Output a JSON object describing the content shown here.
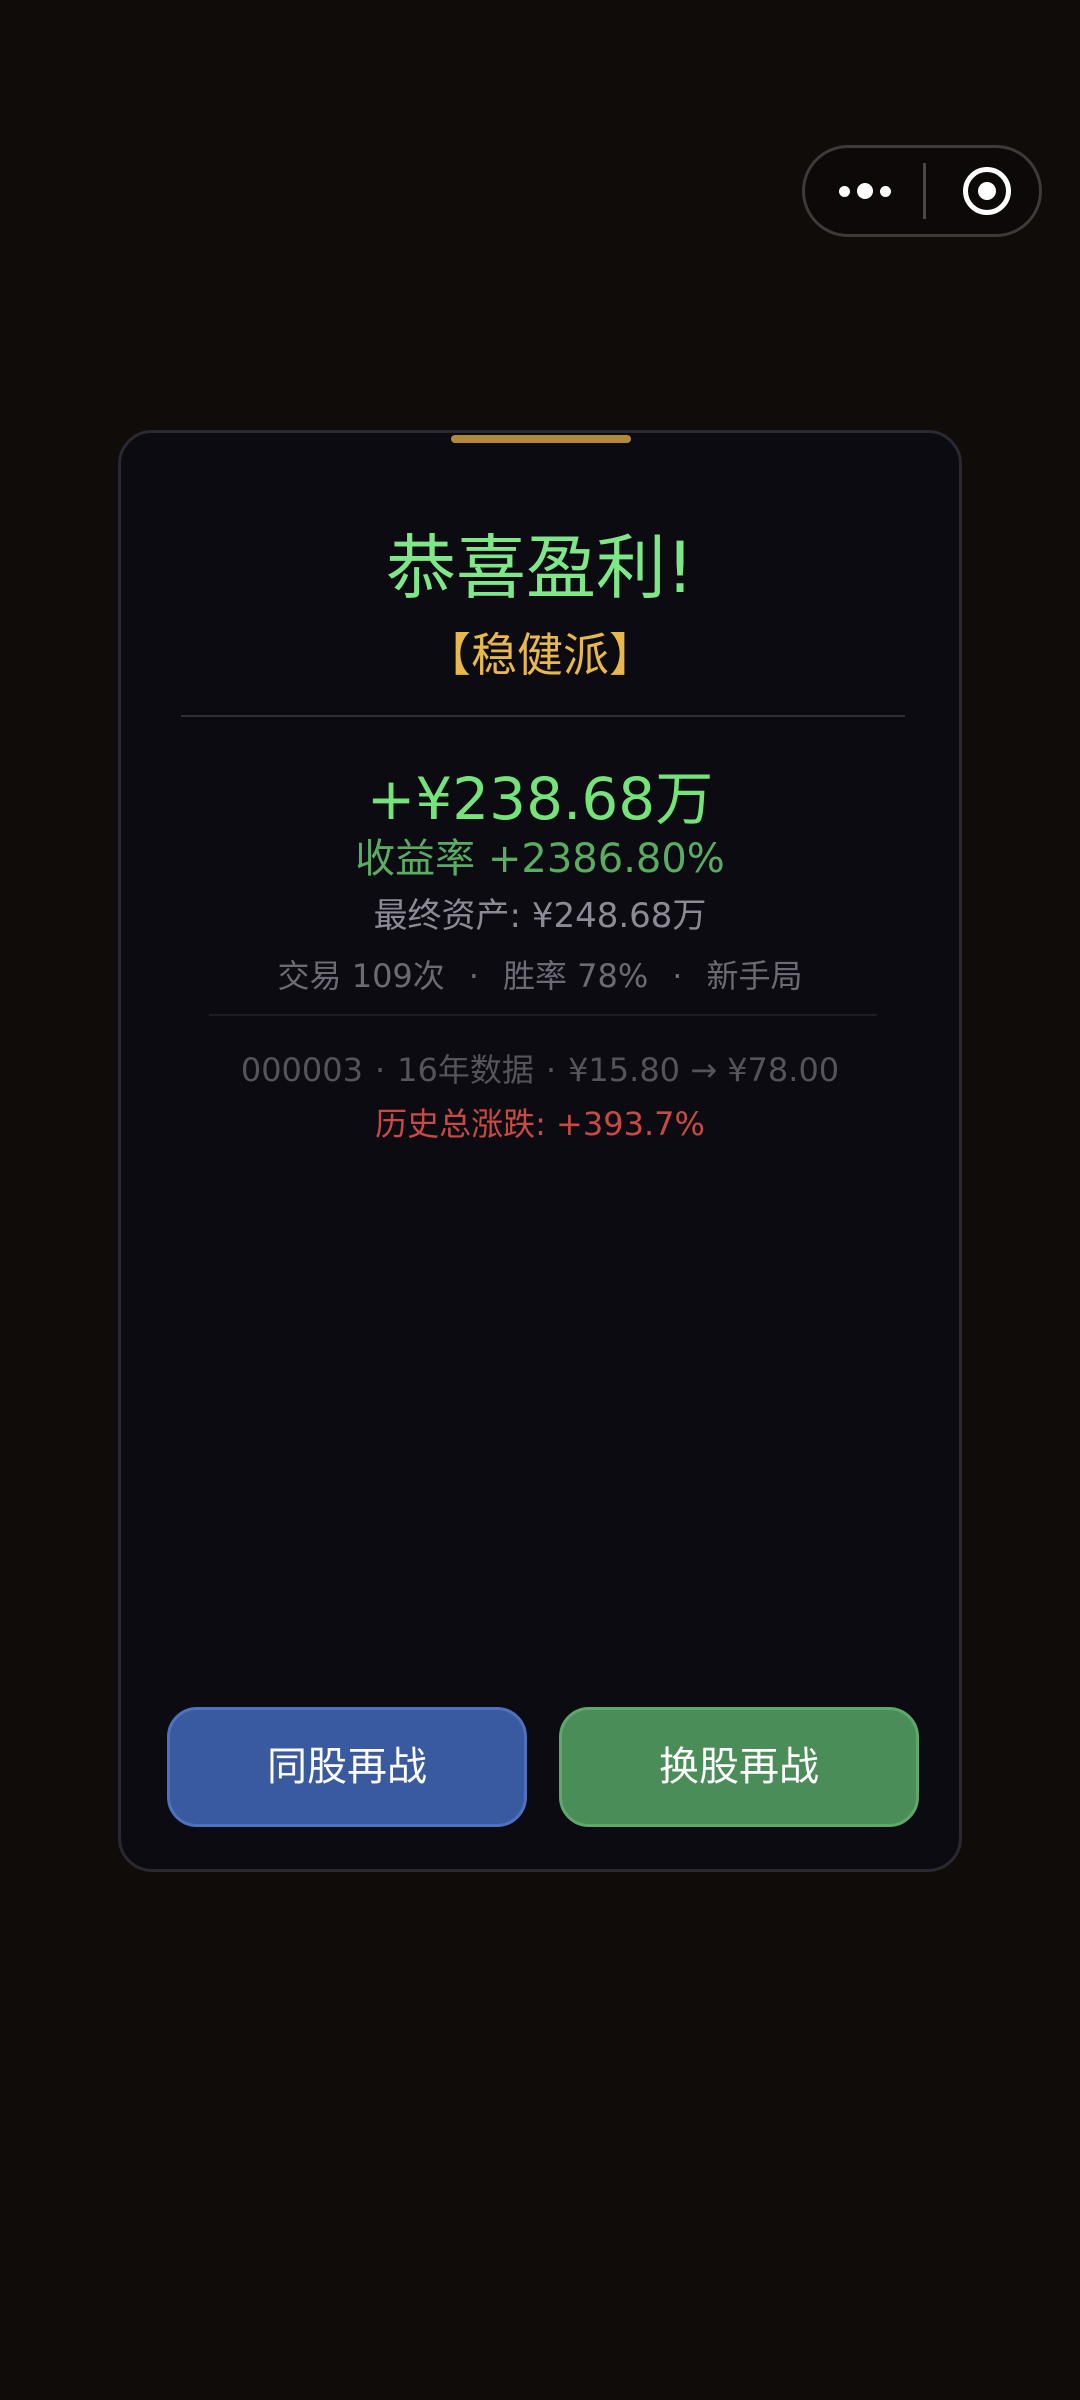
{
  "capsule": {
    "more_icon": "more-dots-icon",
    "close_icon": "target-circle-icon"
  },
  "result": {
    "title": "恭喜盈利!",
    "badge": "【稳健派】",
    "profit": "+¥238.68万",
    "return_rate": "收益率 +2386.80%",
    "final_assets": "最终资产: ¥248.68万",
    "stats": {
      "trades": "交易 109次",
      "win_rate": "胜率 78%",
      "level": "新手局",
      "separator": "·"
    },
    "stock": {
      "code": "000003",
      "years": "16年数据",
      "price_range": "¥15.80 → ¥78.00",
      "separator": "·"
    },
    "history_change": "历史总涨跌: +393.7%"
  },
  "buttons": {
    "same_stock": "同股再战",
    "switch_stock": "换股再战"
  },
  "colors": {
    "background": "#100c0a",
    "card": "#0c0b12",
    "profit_green": "#7ee787",
    "badge_gold": "#e8b94a",
    "history_red": "#c94a44",
    "button_blue": "#3a5aa0",
    "button_green": "#4b8d58"
  }
}
